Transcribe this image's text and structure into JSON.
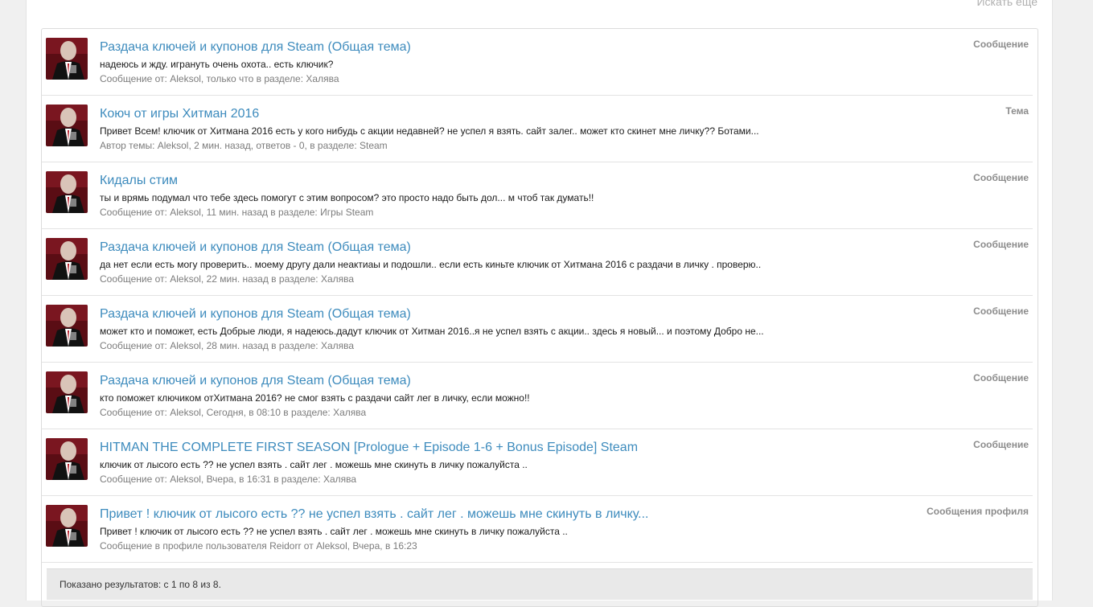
{
  "header": {
    "search_more": "Искать еще"
  },
  "results": [
    {
      "title": "Раздача ключей и купонов для Steam (Общая тема)",
      "snippet": "надеюсь и жду. игрануть очень охота.. есть ключик?",
      "meta_prefix": "Сообщение от: ",
      "user": "Aleksol",
      "when": ", только что в разделе: ",
      "section": "Халява",
      "type": "Сообщение"
    },
    {
      "title": "Коюч от игры Хитман 2016",
      "snippet": "Привет Всем! ключик от Хитмана 2016 есть у кого нибудь с акции недавней? не успел я взять. сайт залег.. может кто скинет мне личку?? Ботами...",
      "meta_prefix": "Автор темы: ",
      "user": "Aleksol",
      "when": ", 2 мин. назад, ответов - 0, в разделе: ",
      "section": "Steam",
      "type": "Тема"
    },
    {
      "title": "Кидалы стим",
      "snippet": "ты и врямь подумал что тебе здесь помогут с этим вопросом? это просто надо быть дол... м чтоб так думать!!",
      "meta_prefix": "Сообщение от: ",
      "user": "Aleksol",
      "when": ", 11 мин. назад в разделе: ",
      "section": "Игры Steam",
      "type": "Сообщение"
    },
    {
      "title": "Раздача ключей и купонов для Steam (Общая тема)",
      "snippet": "да нет если есть могу проверить.. моему другу дали неактиаы и подошли.. если есть киньте ключик от Хитмана 2016 с раздачи в личку . проверю..",
      "meta_prefix": "Сообщение от: ",
      "user": "Aleksol",
      "when": ", 22 мин. назад в разделе: ",
      "section": "Халява",
      "type": "Сообщение"
    },
    {
      "title": "Раздача ключей и купонов для Steam (Общая тема)",
      "snippet": "может кто и поможет, есть Добрые люди, я надеюсь.дадут ключик от Хитман 2016..я не успел взять с акции.. здесь я новый... и поэтому Добро не...",
      "meta_prefix": "Сообщение от: ",
      "user": "Aleksol",
      "when": ", 28 мин. назад в разделе: ",
      "section": "Халява",
      "type": "Сообщение"
    },
    {
      "title": "Раздача ключей и купонов для Steam (Общая тема)",
      "snippet": "кто поможет ключиком отХитмана 2016? не смог взять с раздачи сайт лег в личку, если можно!!",
      "meta_prefix": "Сообщение от: ",
      "user": "Aleksol",
      "when": ", Сегодня, в 08:10 в разделе: ",
      "section": "Халява",
      "type": "Сообщение"
    },
    {
      "title": "HITMAN THE COMPLETE FIRST SEASON [Prologue + Episode 1-6 + Bonus Episode] Steam",
      "snippet": "ключик от лысого есть ?? не успел взять . сайт лег . можешь мне скинуть в личку пожалуйста ..",
      "meta_prefix": "Сообщение от: ",
      "user": "Aleksol",
      "when": ", Вчера, в 16:31 в разделе: ",
      "section": "Халява",
      "type": "Сообщение"
    },
    {
      "title": "Привет ! ключик от лысого есть ?? не успел взять . сайт лег . можешь мне скинуть в личку...",
      "snippet": "Привет ! ключик от лысого есть ?? не успел взять . сайт лег . можешь мне скинуть в личку пожалуйста ..",
      "meta_prefix": "Сообщение в профиле пользователя ",
      "user": "Reidorr",
      "when": " от ",
      "section": "Aleksol, Вчера, в 16:23",
      "type": "Сообщения профиля"
    }
  ],
  "footer": {
    "summary": "Показано результатов: с 1 по 8 из 8."
  },
  "colors": {
    "link": "#3d8bbd",
    "meta": "#7c7c7c",
    "type": "#8c8c8c",
    "footer_bg": "#e9e9e9"
  },
  "icons": {
    "avatar": "user-avatar-image"
  }
}
